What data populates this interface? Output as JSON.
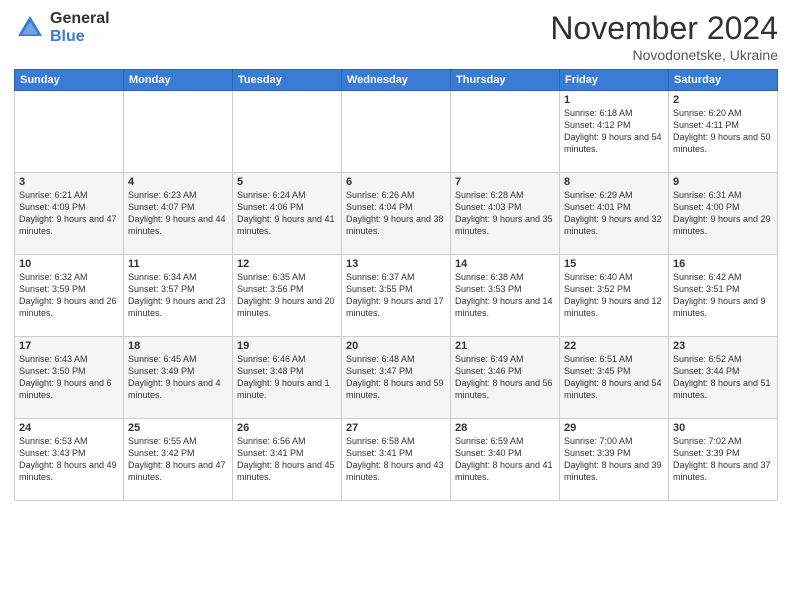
{
  "header": {
    "logo_general": "General",
    "logo_blue": "Blue",
    "month_title": "November 2024",
    "location": "Novodonetske, Ukraine"
  },
  "days_of_week": [
    "Sunday",
    "Monday",
    "Tuesday",
    "Wednesday",
    "Thursday",
    "Friday",
    "Saturday"
  ],
  "weeks": [
    [
      {
        "day": "",
        "sunrise": "",
        "sunset": "",
        "daylight": ""
      },
      {
        "day": "",
        "sunrise": "",
        "sunset": "",
        "daylight": ""
      },
      {
        "day": "",
        "sunrise": "",
        "sunset": "",
        "daylight": ""
      },
      {
        "day": "",
        "sunrise": "",
        "sunset": "",
        "daylight": ""
      },
      {
        "day": "",
        "sunrise": "",
        "sunset": "",
        "daylight": ""
      },
      {
        "day": "1",
        "sunrise": "Sunrise: 6:18 AM",
        "sunset": "Sunset: 4:12 PM",
        "daylight": "Daylight: 9 hours and 54 minutes."
      },
      {
        "day": "2",
        "sunrise": "Sunrise: 6:20 AM",
        "sunset": "Sunset: 4:11 PM",
        "daylight": "Daylight: 9 hours and 50 minutes."
      }
    ],
    [
      {
        "day": "3",
        "sunrise": "Sunrise: 6:21 AM",
        "sunset": "Sunset: 4:09 PM",
        "daylight": "Daylight: 9 hours and 47 minutes."
      },
      {
        "day": "4",
        "sunrise": "Sunrise: 6:23 AM",
        "sunset": "Sunset: 4:07 PM",
        "daylight": "Daylight: 9 hours and 44 minutes."
      },
      {
        "day": "5",
        "sunrise": "Sunrise: 6:24 AM",
        "sunset": "Sunset: 4:06 PM",
        "daylight": "Daylight: 9 hours and 41 minutes."
      },
      {
        "day": "6",
        "sunrise": "Sunrise: 6:26 AM",
        "sunset": "Sunset: 4:04 PM",
        "daylight": "Daylight: 9 hours and 38 minutes."
      },
      {
        "day": "7",
        "sunrise": "Sunrise: 6:28 AM",
        "sunset": "Sunset: 4:03 PM",
        "daylight": "Daylight: 9 hours and 35 minutes."
      },
      {
        "day": "8",
        "sunrise": "Sunrise: 6:29 AM",
        "sunset": "Sunset: 4:01 PM",
        "daylight": "Daylight: 9 hours and 32 minutes."
      },
      {
        "day": "9",
        "sunrise": "Sunrise: 6:31 AM",
        "sunset": "Sunset: 4:00 PM",
        "daylight": "Daylight: 9 hours and 29 minutes."
      }
    ],
    [
      {
        "day": "10",
        "sunrise": "Sunrise: 6:32 AM",
        "sunset": "Sunset: 3:59 PM",
        "daylight": "Daylight: 9 hours and 26 minutes."
      },
      {
        "day": "11",
        "sunrise": "Sunrise: 6:34 AM",
        "sunset": "Sunset: 3:57 PM",
        "daylight": "Daylight: 9 hours and 23 minutes."
      },
      {
        "day": "12",
        "sunrise": "Sunrise: 6:35 AM",
        "sunset": "Sunset: 3:56 PM",
        "daylight": "Daylight: 9 hours and 20 minutes."
      },
      {
        "day": "13",
        "sunrise": "Sunrise: 6:37 AM",
        "sunset": "Sunset: 3:55 PM",
        "daylight": "Daylight: 9 hours and 17 minutes."
      },
      {
        "day": "14",
        "sunrise": "Sunrise: 6:38 AM",
        "sunset": "Sunset: 3:53 PM",
        "daylight": "Daylight: 9 hours and 14 minutes."
      },
      {
        "day": "15",
        "sunrise": "Sunrise: 6:40 AM",
        "sunset": "Sunset: 3:52 PM",
        "daylight": "Daylight: 9 hours and 12 minutes."
      },
      {
        "day": "16",
        "sunrise": "Sunrise: 6:42 AM",
        "sunset": "Sunset: 3:51 PM",
        "daylight": "Daylight: 9 hours and 9 minutes."
      }
    ],
    [
      {
        "day": "17",
        "sunrise": "Sunrise: 6:43 AM",
        "sunset": "Sunset: 3:50 PM",
        "daylight": "Daylight: 9 hours and 6 minutes."
      },
      {
        "day": "18",
        "sunrise": "Sunrise: 6:45 AM",
        "sunset": "Sunset: 3:49 PM",
        "daylight": "Daylight: 9 hours and 4 minutes."
      },
      {
        "day": "19",
        "sunrise": "Sunrise: 6:46 AM",
        "sunset": "Sunset: 3:48 PM",
        "daylight": "Daylight: 9 hours and 1 minute."
      },
      {
        "day": "20",
        "sunrise": "Sunrise: 6:48 AM",
        "sunset": "Sunset: 3:47 PM",
        "daylight": "Daylight: 8 hours and 59 minutes."
      },
      {
        "day": "21",
        "sunrise": "Sunrise: 6:49 AM",
        "sunset": "Sunset: 3:46 PM",
        "daylight": "Daylight: 8 hours and 56 minutes."
      },
      {
        "day": "22",
        "sunrise": "Sunrise: 6:51 AM",
        "sunset": "Sunset: 3:45 PM",
        "daylight": "Daylight: 8 hours and 54 minutes."
      },
      {
        "day": "23",
        "sunrise": "Sunrise: 6:52 AM",
        "sunset": "Sunset: 3:44 PM",
        "daylight": "Daylight: 8 hours and 51 minutes."
      }
    ],
    [
      {
        "day": "24",
        "sunrise": "Sunrise: 6:53 AM",
        "sunset": "Sunset: 3:43 PM",
        "daylight": "Daylight: 8 hours and 49 minutes."
      },
      {
        "day": "25",
        "sunrise": "Sunrise: 6:55 AM",
        "sunset": "Sunset: 3:42 PM",
        "daylight": "Daylight: 8 hours and 47 minutes."
      },
      {
        "day": "26",
        "sunrise": "Sunrise: 6:56 AM",
        "sunset": "Sunset: 3:41 PM",
        "daylight": "Daylight: 8 hours and 45 minutes."
      },
      {
        "day": "27",
        "sunrise": "Sunrise: 6:58 AM",
        "sunset": "Sunset: 3:41 PM",
        "daylight": "Daylight: 8 hours and 43 minutes."
      },
      {
        "day": "28",
        "sunrise": "Sunrise: 6:59 AM",
        "sunset": "Sunset: 3:40 PM",
        "daylight": "Daylight: 8 hours and 41 minutes."
      },
      {
        "day": "29",
        "sunrise": "Sunrise: 7:00 AM",
        "sunset": "Sunset: 3:39 PM",
        "daylight": "Daylight: 8 hours and 39 minutes."
      },
      {
        "day": "30",
        "sunrise": "Sunrise: 7:02 AM",
        "sunset": "Sunset: 3:39 PM",
        "daylight": "Daylight: 8 hours and 37 minutes."
      }
    ]
  ]
}
